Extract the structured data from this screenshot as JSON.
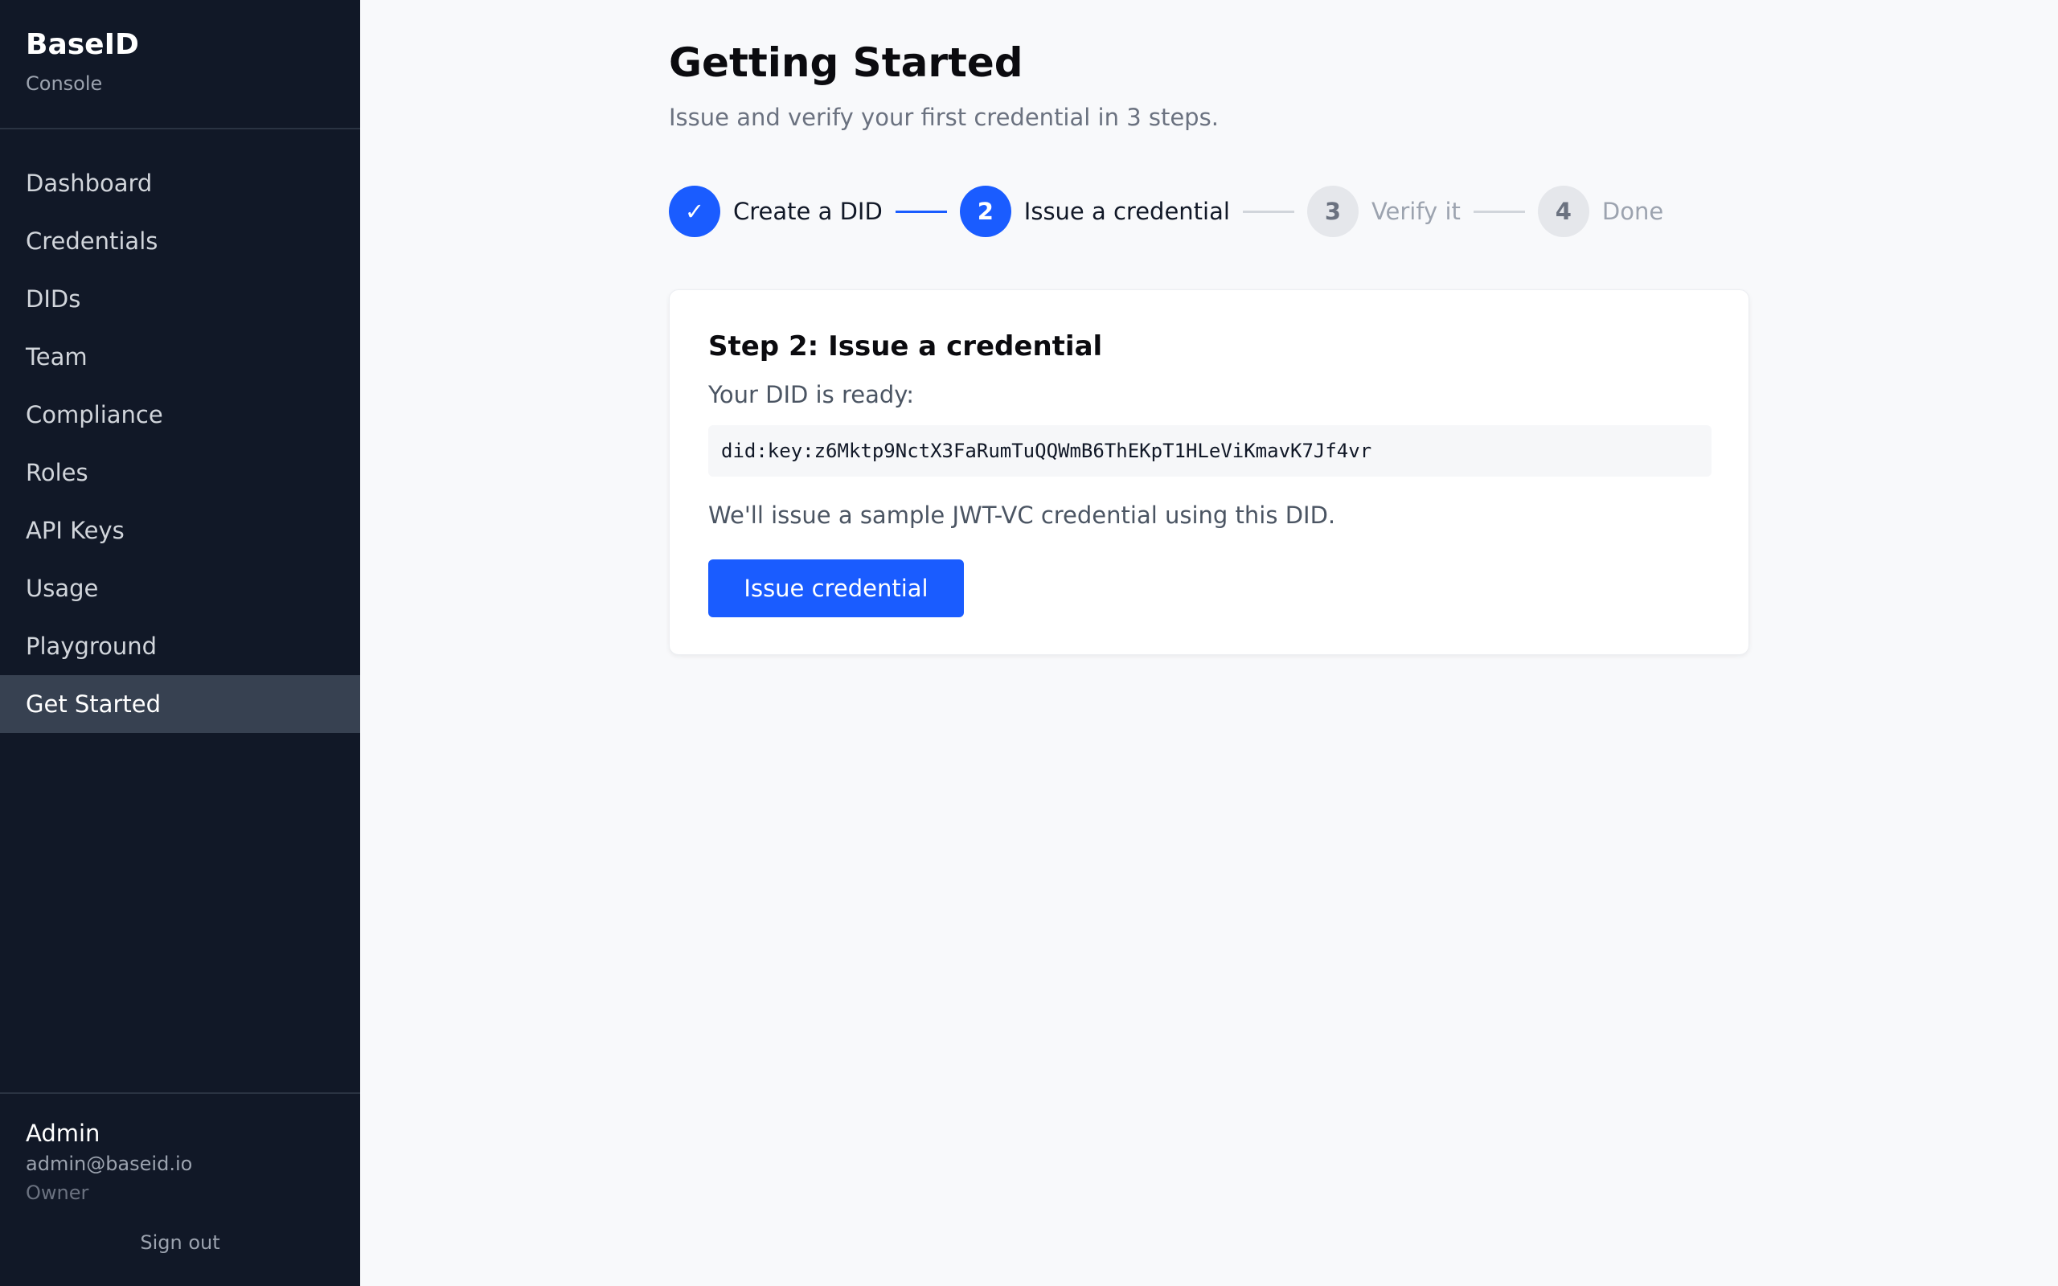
{
  "brand": {
    "title": "BaseID",
    "subtitle": "Console"
  },
  "sidebar": {
    "items": [
      {
        "label": "Dashboard"
      },
      {
        "label": "Credentials"
      },
      {
        "label": "DIDs"
      },
      {
        "label": "Team"
      },
      {
        "label": "Compliance"
      },
      {
        "label": "Roles"
      },
      {
        "label": "API Keys"
      },
      {
        "label": "Usage"
      },
      {
        "label": "Playground"
      },
      {
        "label": "Get Started",
        "active": true
      }
    ]
  },
  "user": {
    "name": "Admin",
    "email": "admin@baseid.io",
    "role": "Owner",
    "sign_out": "Sign out"
  },
  "page": {
    "title": "Getting Started",
    "subtitle": "Issue and verify your first credential in 3 steps."
  },
  "stepper": {
    "steps": [
      {
        "marker": "✓",
        "label": "Create a DID",
        "state": "done",
        "icon": "check-icon"
      },
      {
        "marker": "2",
        "label": "Issue a credential",
        "state": "current"
      },
      {
        "marker": "3",
        "label": "Verify it",
        "state": "pending"
      },
      {
        "marker": "4",
        "label": "Done",
        "state": "pending"
      }
    ]
  },
  "card": {
    "title": "Step 2: Issue a credential",
    "did_label": "Your DID is ready:",
    "did_value": "did:key:z6Mktp9NctX3FaRumTuQQWmB6ThEKpT1HLeViKmavK7Jf4vr",
    "note": "We'll issue a sample JWT-VC credential using this DID.",
    "button_label": "Issue credential"
  },
  "colors": {
    "sidebar_bg": "#111827",
    "active_nav_bg": "#374151",
    "accent": "#1a5cff",
    "page_bg": "#f8f9fb"
  }
}
